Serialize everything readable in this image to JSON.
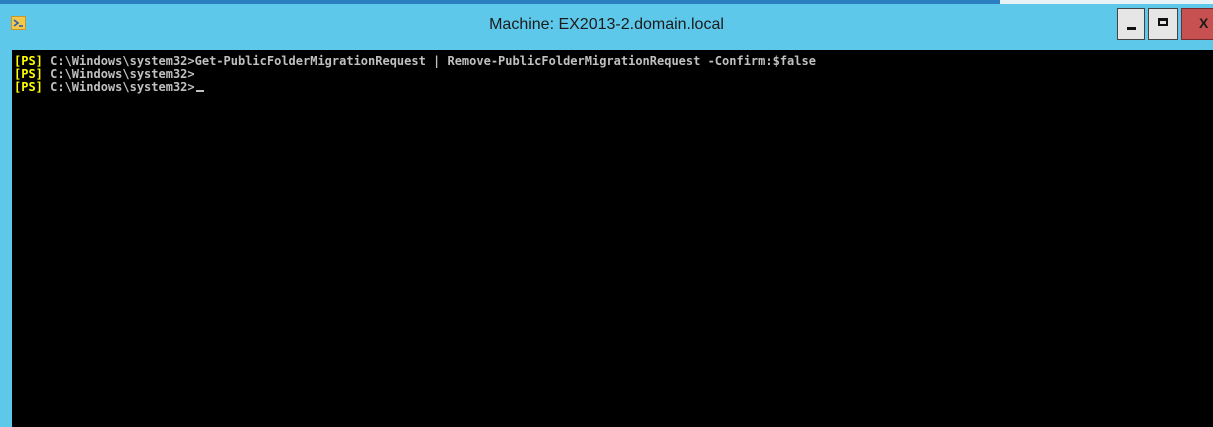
{
  "window": {
    "title": "Machine: EX2013-2.domain.local",
    "controls": {
      "minimize": "minimize",
      "maximize": "maximize",
      "close": "X"
    },
    "colors": {
      "titlebar": "#5ec8ea",
      "console_bg": "#000000",
      "console_fg": "#c0c0c0",
      "prompt_tag": "#ffff00",
      "close_button": "#c75050"
    },
    "icon": "powershell-icon"
  },
  "console": {
    "lines": [
      {
        "tag": "[PS]",
        "text": " C:\\Windows\\system32>Get-PublicFolderMigrationRequest | Remove-PublicFolderMigrationRequest -Confirm:$false"
      },
      {
        "tag": "[PS]",
        "text": " C:\\Windows\\system32>"
      },
      {
        "tag": "[PS]",
        "text": " C:\\Windows\\system32>"
      }
    ]
  }
}
